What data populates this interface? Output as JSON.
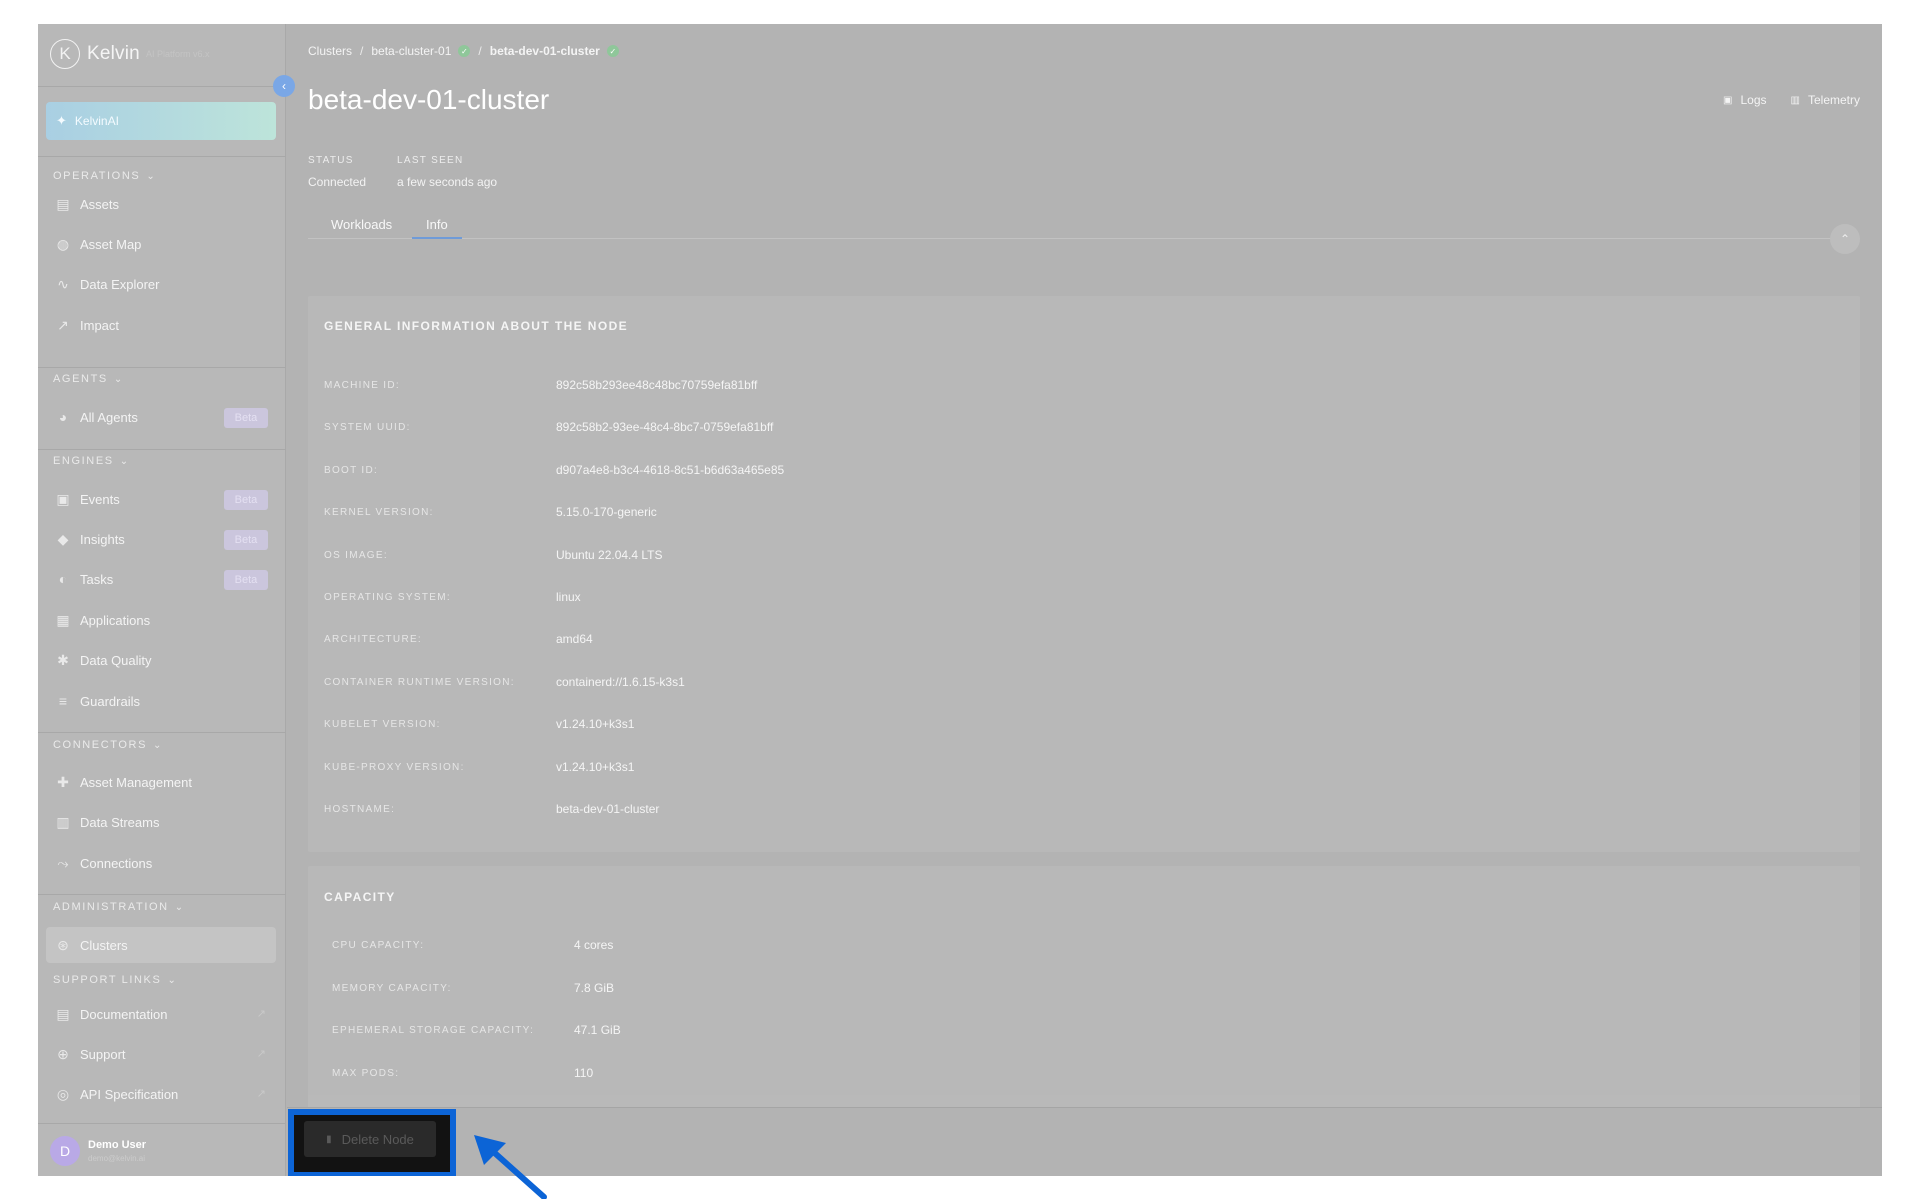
{
  "app": {
    "logo_letter": "K",
    "logo_text": "Kelvin",
    "logo_subtext": "AI Platform v6.x",
    "kelvinai_label": "KelvinAI"
  },
  "sidebar": {
    "sections": {
      "operations": "OPERATIONS",
      "agents": "AGENTS",
      "engines": "ENGINES",
      "connectors": "CONNECTORS",
      "administration": "ADMINISTRATION",
      "support": "SUPPORT LINKS"
    },
    "items": {
      "assets": "Assets",
      "asset_map": "Asset Map",
      "data_explorer": "Data Explorer",
      "impact": "Impact",
      "all_agents": "All Agents",
      "events": "Events",
      "insights": "Insights",
      "tasks": "Tasks",
      "applications": "Applications",
      "data_quality": "Data Quality",
      "guardrails": "Guardrails",
      "asset_management": "Asset Management",
      "data_streams": "Data Streams",
      "connections": "Connections",
      "clusters": "Clusters",
      "documentation": "Documentation",
      "support": "Support",
      "api_specification": "API Specification"
    },
    "badge": "Beta",
    "user": {
      "initial": "D",
      "name": "Demo User",
      "email": "demo@kelvin.ai"
    }
  },
  "breadcrumb": {
    "root": "Clusters",
    "cluster": "beta-cluster-01",
    "current": "beta-dev-01-cluster"
  },
  "page": {
    "title": "beta-dev-01-cluster",
    "actions": {
      "logs": "Logs",
      "telemetry": "Telemetry"
    },
    "status_label": "STATUS",
    "status_value": "Connected",
    "last_seen_label": "LAST SEEN",
    "last_seen_value": "a few seconds ago",
    "tabs": {
      "workloads": "Workloads",
      "info": "Info"
    }
  },
  "general": {
    "title": "GENERAL INFORMATION ABOUT THE NODE",
    "rows": [
      {
        "label": "MACHINE ID:",
        "value": "892c58b293ee48c48bc70759efa81bff"
      },
      {
        "label": "SYSTEM UUID:",
        "value": "892c58b2-93ee-48c4-8bc7-0759efa81bff"
      },
      {
        "label": "BOOT ID:",
        "value": "d907a4e8-b3c4-4618-8c51-b6d63a465e85"
      },
      {
        "label": "KERNEL VERSION:",
        "value": "5.15.0-170-generic"
      },
      {
        "label": "OS IMAGE:",
        "value": "Ubuntu 22.04.4 LTS"
      },
      {
        "label": "OPERATING SYSTEM:",
        "value": "linux"
      },
      {
        "label": "ARCHITECTURE:",
        "value": "amd64"
      },
      {
        "label": "CONTAINER RUNTIME VERSION:",
        "value": "containerd://1.6.15-k3s1"
      },
      {
        "label": "KUBELET VERSION:",
        "value": "v1.24.10+k3s1"
      },
      {
        "label": "KUBE-PROXY VERSION:",
        "value": "v1.24.10+k3s1"
      },
      {
        "label": "HOSTNAME:",
        "value": "beta-dev-01-cluster"
      }
    ]
  },
  "capacity": {
    "title": "CAPACITY",
    "rows": [
      {
        "label": "CPU CAPACITY:",
        "value": "4 cores"
      },
      {
        "label": "MEMORY CAPACITY:",
        "value": "7.8 GiB"
      },
      {
        "label": "EPHEMERAL STORAGE CAPACITY:",
        "value": "47.1 GiB"
      },
      {
        "label": "MAX PODS:",
        "value": "110"
      }
    ]
  },
  "footer": {
    "delete_label": "Delete Node"
  },
  "colors": {
    "highlight": "#0c64d6",
    "accent": "#6f9bd8",
    "connected": "#8fc79a"
  }
}
